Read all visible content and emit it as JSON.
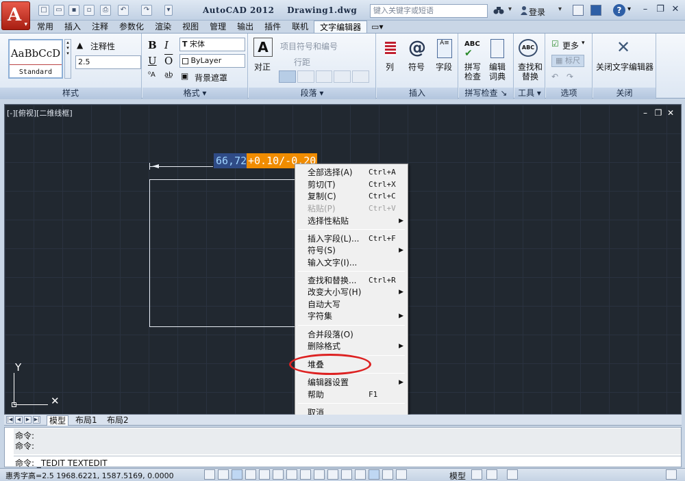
{
  "title_bar": {
    "app_title": "AutoCAD 2012    Drawing1.dwg",
    "search_placeholder": "键入关键字或短语",
    "login_label": "登录",
    "help_label": "?"
  },
  "ribbon_tabs": [
    "常用",
    "插入",
    "注释",
    "参数化",
    "渲染",
    "视图",
    "管理",
    "输出",
    "插件",
    "联机",
    "文字编辑器"
  ],
  "active_tab": "文字编辑器",
  "ribbon": {
    "style_panel": {
      "title": "样式",
      "style_preview": "AaBbCcD",
      "style_name": "Standard",
      "annotative_label": "注释性",
      "text_height": "2.5"
    },
    "format_panel": {
      "title": "格式",
      "bold": "B",
      "italic": "I",
      "underline": "U",
      "overline": "O",
      "font": "宋体",
      "color": "ByLayer",
      "background_mask": "背景遮罩"
    },
    "paragraph_panel": {
      "title": "段落",
      "justify_label": "对正",
      "bullets_label": "项目符号和编号",
      "line_spacing_label": "行距"
    },
    "insert_panel": {
      "title": "插入",
      "columns": "列",
      "symbol": "符号",
      "field": "字段"
    },
    "spell_panel": {
      "title": "拼写检查",
      "spell_check": "拼写检查",
      "edit_dictionary": "编辑词典"
    },
    "tools_panel": {
      "title": "工具",
      "find_replace": "查找和替换"
    },
    "options_panel": {
      "title": "选项",
      "more": "更多",
      "ruler": "标尺"
    },
    "close_panel": {
      "title": "关闭",
      "close_editor": "关闭文字编辑器"
    }
  },
  "viewport": {
    "label": "[-][俯视][二维线框]"
  },
  "mtext": {
    "selected": "66,72",
    "rest": "+0.10/-0.20"
  },
  "context_menu": {
    "items": [
      {
        "label": "全部选择(A)",
        "shortcut": "Ctrl+A",
        "enabled": true
      },
      {
        "label": "剪切(T)",
        "shortcut": "Ctrl+X",
        "enabled": true
      },
      {
        "label": "复制(C)",
        "shortcut": "Ctrl+C",
        "enabled": true
      },
      {
        "label": "粘贴(P)",
        "shortcut": "Ctrl+V",
        "enabled": false
      },
      {
        "label": "选择性粘贴",
        "submenu": true,
        "enabled": true
      },
      {
        "label": "插入字段(L)...",
        "shortcut": "Ctrl+F",
        "enabled": true
      },
      {
        "label": "符号(S)",
        "submenu": true,
        "enabled": true
      },
      {
        "label": "输入文字(I)...",
        "enabled": true
      },
      {
        "label": "查找和替换...",
        "shortcut": "Ctrl+R",
        "enabled": true
      },
      {
        "label": "改变大小写(H)",
        "submenu": true,
        "enabled": true
      },
      {
        "label": "自动大写",
        "enabled": true
      },
      {
        "label": "字符集",
        "submenu": true,
        "enabled": true
      },
      {
        "label": "合并段落(O)",
        "enabled": true
      },
      {
        "label": "删除格式",
        "submenu": true,
        "enabled": true
      },
      {
        "label": "堆叠",
        "enabled": true
      },
      {
        "label": "编辑器设置",
        "submenu": true,
        "enabled": true
      },
      {
        "label": "帮助",
        "shortcut": "F1",
        "enabled": true
      },
      {
        "label": "取消",
        "enabled": true
      }
    ]
  },
  "layout_tabs": [
    "模型",
    "布局1",
    "布局2"
  ],
  "command": {
    "history": [
      "命令:",
      "命令:"
    ],
    "current": "命令: _TEDIT TEXTEDIT"
  },
  "status": {
    "coords": "惠秀字高=2.5    1968.6221, 1587.5169, 0.0000",
    "model_label": "模型"
  },
  "colors": {
    "canvas_bg": "#212830",
    "selection_bg": "#2f4b86",
    "text_highlight": "#f08c00",
    "annotation_red": "#dd2222"
  }
}
